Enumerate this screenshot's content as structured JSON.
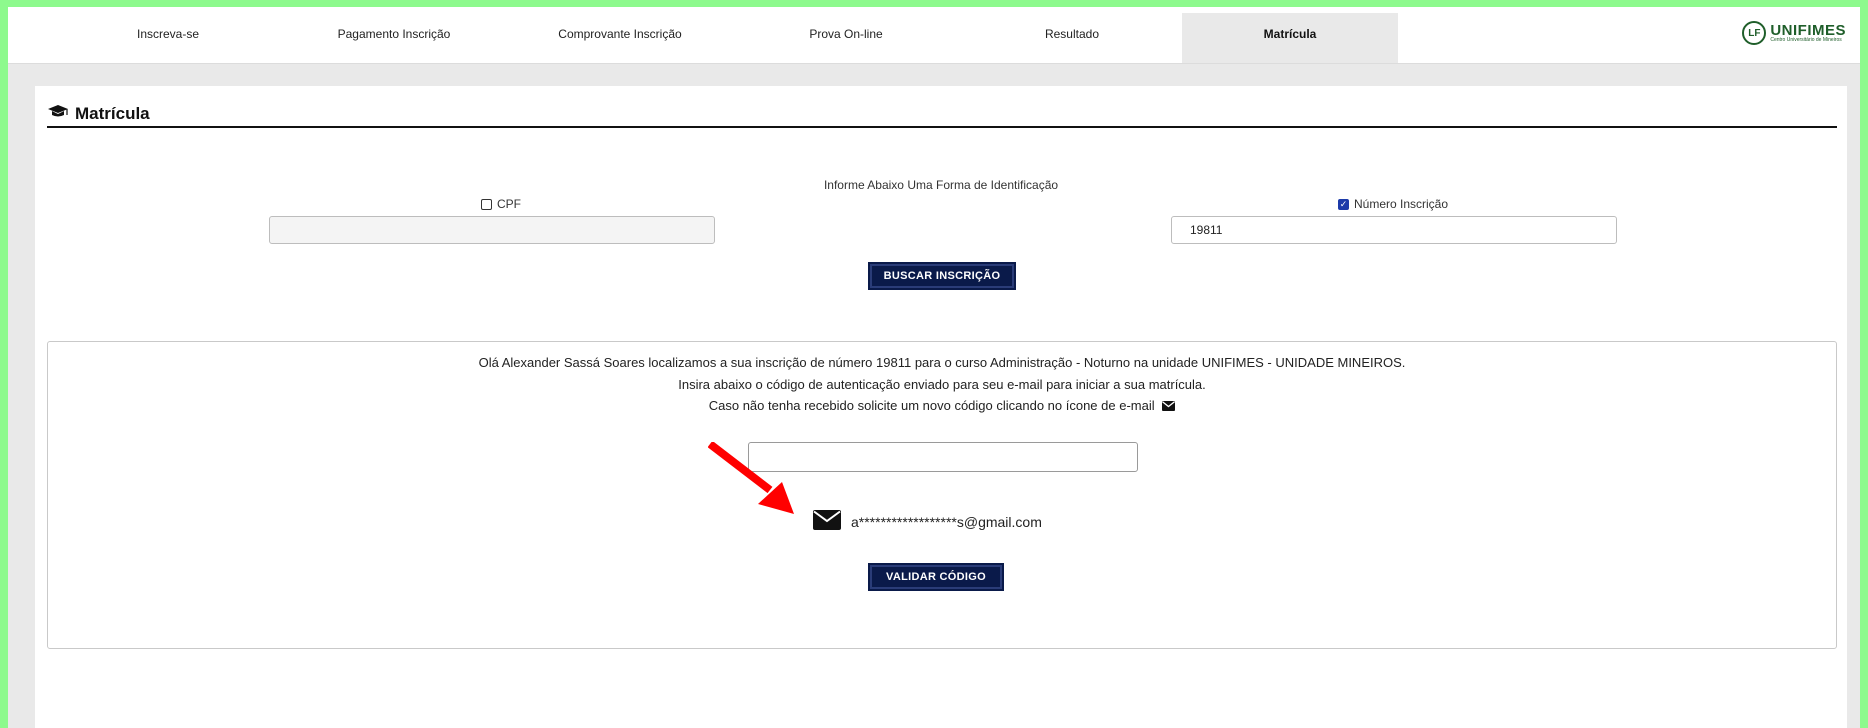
{
  "nav": {
    "tabs": [
      {
        "label": "Inscreva-se"
      },
      {
        "label": "Pagamento Inscrição"
      },
      {
        "label": "Comprovante Inscrição"
      },
      {
        "label": "Prova On-line"
      },
      {
        "label": "Resultado"
      },
      {
        "label": "Matrícula"
      }
    ],
    "active_tab": "Matrícula",
    "logo_name": "UNIFIMES",
    "logo_mark": "LF",
    "logo_sub": "Centro Universitário de Mineiros"
  },
  "section": {
    "title": "Matrícula",
    "icon": "graduation-cap-icon"
  },
  "form": {
    "ident_label": "Informe Abaixo Uma Forma de Identificação",
    "cpf_label": "CPF",
    "cpf_checked": false,
    "cpf_value": "",
    "numero_label": "Número Inscrição",
    "numero_checked": true,
    "numero_value": "19811",
    "search_button": "BUSCAR INSCRIÇÃO"
  },
  "message": {
    "line1": "Olá Alexander Sassá Soares localizamos a sua inscrição de número 19811 para o curso Administração - Noturno na unidade UNIFIMES - UNIDADE MINEIROS.",
    "line2": "Insira abaixo o código de autenticação enviado para seu e-mail para iniciar a sua matrícula.",
    "line3": "Caso não tenha recebido solicite um novo código clicando no ícone de e-mail",
    "code_value": "",
    "masked_email": "a******************s@gmail.com",
    "validate_button": "VALIDAR CÓDIGO"
  },
  "colors": {
    "frame_border": "#8dfa8d",
    "button_bg": "#0a1a4a",
    "arrow": "#ff0000",
    "brand": "#1f5e2a"
  }
}
